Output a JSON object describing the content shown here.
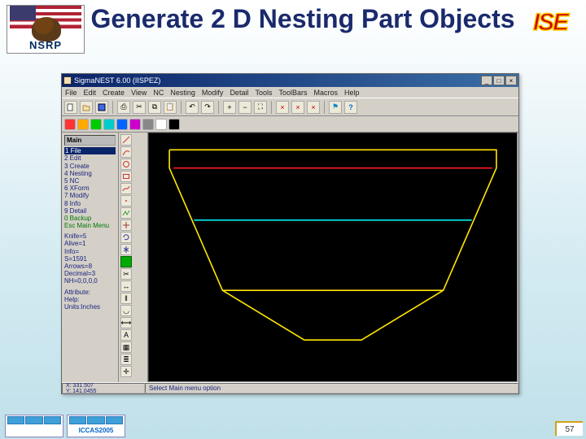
{
  "slide": {
    "title": "Generate 2 D Nesting Part Objects",
    "number": "57",
    "nsrp_label": "NSRP",
    "ise_label": "ISE",
    "iccas_label": "ICCAS2005"
  },
  "app": {
    "title": "SigmaNEST 6.00 (IISPEZ)",
    "menus": [
      "File",
      "Edit",
      "Create",
      "View",
      "NC",
      "Nesting",
      "Modify",
      "Detail",
      "Tools",
      "ToolBars",
      "Macros",
      "Help"
    ],
    "left_panel": {
      "header": "Main",
      "items": [
        "1 File",
        "2 Edit",
        "3 Create",
        "4 Nesting",
        "5 NC",
        "6 XForm",
        "7 Modify",
        "8 Info",
        "9 Detail"
      ],
      "special1": "0 Backup",
      "special2": "Esc Main Menu",
      "group2": [
        "Knife=5",
        "Alive=1",
        "Info=",
        "S=1591",
        "Arrows=8",
        "Decimal=3",
        "NH=0,0,0,0"
      ],
      "group3": [
        "Attribute:",
        "Help:",
        "Units:Inches"
      ]
    },
    "status": {
      "coords": "X: 331.507\nY: 141.0455",
      "message": "Select Main menu option"
    },
    "colors": {
      "hull_outer": "#ffe600",
      "deck_upper": "#ff1a1a",
      "deck_lower": "#00e6e6",
      "canvas_bg": "#000000"
    }
  }
}
